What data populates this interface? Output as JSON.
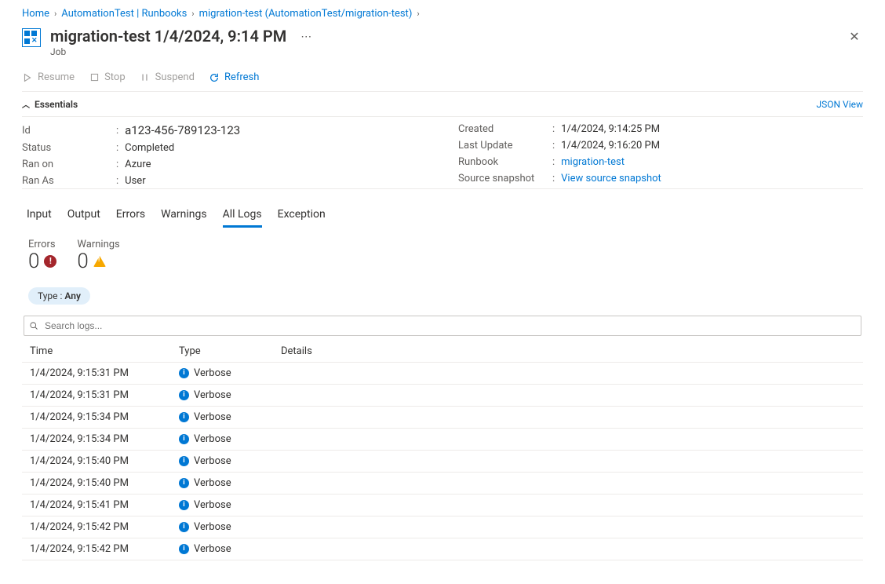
{
  "breadcrumb": [
    {
      "label": "Home"
    },
    {
      "label": "AutomationTest | Runbooks"
    },
    {
      "label": "migration-test (AutomationTest/migration-test)"
    }
  ],
  "header": {
    "title": "migration-test 1/4/2024, 9:14 PM",
    "subtitle": "Job"
  },
  "toolbar": {
    "resume": "Resume",
    "stop": "Stop",
    "suspend": "Suspend",
    "refresh": "Refresh"
  },
  "essentials": {
    "label": "Essentials",
    "json_view": "JSON View",
    "left": [
      {
        "k": "Id",
        "v": "a123-456-789123-123",
        "cls": "id"
      },
      {
        "k": "Status",
        "v": "Completed"
      },
      {
        "k": "Ran on",
        "v": "Azure"
      },
      {
        "k": "Ran As",
        "v": "User"
      }
    ],
    "right": [
      {
        "k": "Created",
        "v": "1/4/2024, 9:14:25 PM"
      },
      {
        "k": "Last Update",
        "v": "1/4/2024, 9:16:20 PM"
      },
      {
        "k": "Runbook",
        "v": "migration-test",
        "link": true
      },
      {
        "k": "Source snapshot",
        "v": "View source snapshot",
        "link": true
      }
    ]
  },
  "tabs": [
    "Input",
    "Output",
    "Errors",
    "Warnings",
    "All Logs",
    "Exception"
  ],
  "active_tab": "All Logs",
  "stats": {
    "errors_label": "Errors",
    "errors": "0",
    "warnings_label": "Warnings",
    "warnings": "0"
  },
  "filter": {
    "prefix": "Type : ",
    "value": "Any"
  },
  "search": {
    "placeholder": "Search logs..."
  },
  "columns": [
    "Time",
    "Type",
    "Details"
  ],
  "logs": [
    {
      "time": "1/4/2024, 9:15:31 PM",
      "type": "Verbose",
      "details": ""
    },
    {
      "time": "1/4/2024, 9:15:31 PM",
      "type": "Verbose",
      "details": ""
    },
    {
      "time": "1/4/2024, 9:15:34 PM",
      "type": "Verbose",
      "details": ""
    },
    {
      "time": "1/4/2024, 9:15:34 PM",
      "type": "Verbose",
      "details": ""
    },
    {
      "time": "1/4/2024, 9:15:40 PM",
      "type": "Verbose",
      "details": ""
    },
    {
      "time": "1/4/2024, 9:15:40 PM",
      "type": "Verbose",
      "details": ""
    },
    {
      "time": "1/4/2024, 9:15:41 PM",
      "type": "Verbose",
      "details": ""
    },
    {
      "time": "1/4/2024, 9:15:42 PM",
      "type": "Verbose",
      "details": ""
    },
    {
      "time": "1/4/2024, 9:15:42 PM",
      "type": "Verbose",
      "details": ""
    }
  ]
}
